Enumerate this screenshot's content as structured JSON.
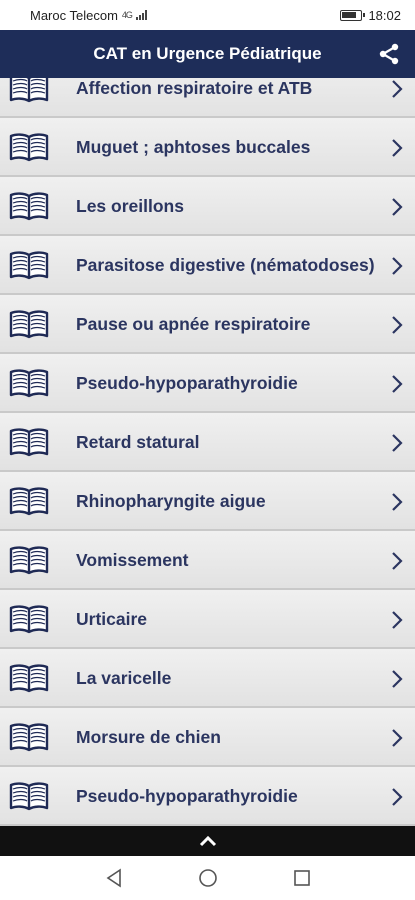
{
  "status_bar": {
    "carrier": "Maroc Telecom",
    "network": "4G",
    "time": "18:02"
  },
  "app_bar": {
    "title": "CAT en Urgence Pédiatrique",
    "share_icon": "share-icon"
  },
  "list": {
    "items": [
      {
        "label": "Affection respiratoire et ATB"
      },
      {
        "label": "Muguet ; aphtoses buccales"
      },
      {
        "label": "Les oreillons"
      },
      {
        "label": "Parasitose digestive (nématodoses)"
      },
      {
        "label": "Pause ou apnée respiratoire"
      },
      {
        "label": "Pseudo-hypoparathyroidie"
      },
      {
        "label": "Retard statural"
      },
      {
        "label": "Rhinopharyngite aigue"
      },
      {
        "label": "Vomissement"
      },
      {
        "label": "Urticaire"
      },
      {
        "label": "La varicelle"
      },
      {
        "label": "Morsure de chien"
      },
      {
        "label": "Pseudo-hypoparathyroidie"
      }
    ]
  },
  "bottom_bar": {
    "icon": "chevron-up-icon"
  },
  "nav_bar": {
    "back_icon": "back-triangle-icon",
    "home_icon": "home-circle-icon",
    "recents_icon": "recents-square-icon"
  },
  "colors": {
    "app_bar": "#1e2d59",
    "row_text": "#2b3560",
    "bottom_bar": "#111111"
  }
}
